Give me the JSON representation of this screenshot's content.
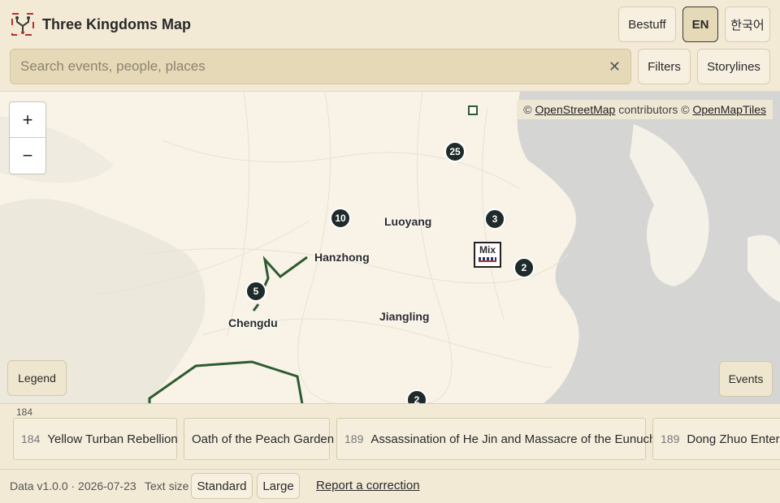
{
  "app": {
    "title": "Three Kingdoms Map"
  },
  "header": {
    "buttons": [
      {
        "label": "Bestuff"
      },
      {
        "label": "EN",
        "active": true
      },
      {
        "label": "한국어"
      }
    ]
  },
  "search": {
    "placeholder": "Search events, people, places",
    "value": ""
  },
  "toolbar": {
    "filters_label": "Filters",
    "storylines_label": "Storylines"
  },
  "map": {
    "zoom_in": "+",
    "zoom_out": "−",
    "attribution": {
      "prefix": "©",
      "osm": "OpenStreetMap",
      "contributors": "contributors ©",
      "omt": "OpenMapTiles"
    },
    "cities": [
      "Luoyang",
      "Hanzhong",
      "Chengdu",
      "Jiangling"
    ],
    "clusters": [
      "25",
      "10",
      "3",
      "2",
      "5",
      "2"
    ],
    "mix_marker": {
      "label": "Mix"
    },
    "legend_label": "Legend",
    "events_label": "Events",
    "colors": {
      "route": "#2e5b30",
      "sea": "#d5d5d3",
      "land": "#f8f3e6",
      "cluster": "#1f2a2a"
    }
  },
  "timeline": {
    "year_marker": "184",
    "events": [
      {
        "year": "184",
        "title": "Yellow Turban Rebellion"
      },
      {
        "year": "",
        "title": "Oath of the Peach Garden"
      },
      {
        "year": "189",
        "title": "Assassination of He Jin and Massacre of the Eunuchs"
      },
      {
        "year": "189",
        "title": "Dong Zhuo Enters"
      }
    ]
  },
  "footer": {
    "version": "Data v1.0.0 · 2026-07-23",
    "text_size_label": "Text size",
    "standard_label": "Standard",
    "large_label": "Large",
    "report_label": "Report a correction"
  }
}
